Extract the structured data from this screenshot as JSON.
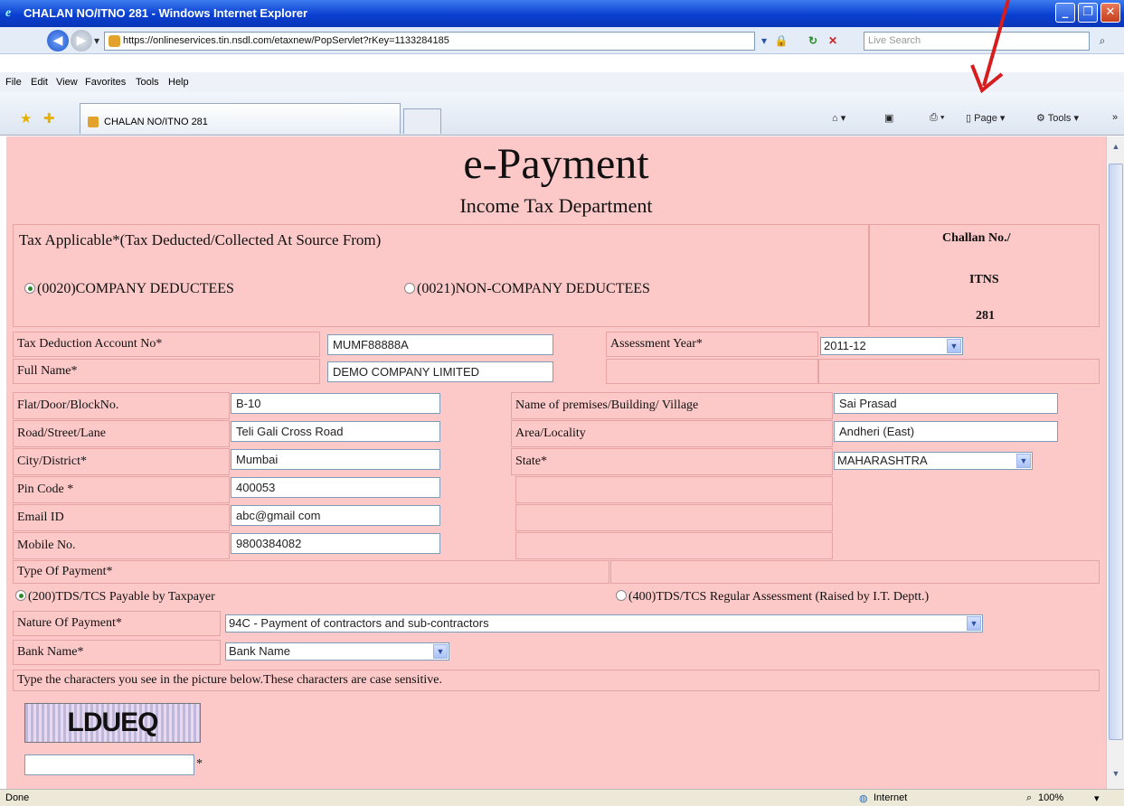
{
  "window": {
    "title": "CHALAN NO/ITNO 281 - Windows Internet Explorer"
  },
  "address": {
    "url": "https://onlineservices.tin.nsdl.com/etaxnew/PopServlet?rKey=1133284185",
    "search_placeholder": "Live Search"
  },
  "menu": [
    "File",
    "Edit",
    "View",
    "Favorites",
    "Tools",
    "Help"
  ],
  "tab": {
    "label": "CHALAN NO/ITNO 281"
  },
  "toolbar": {
    "page": "Page",
    "tools": "Tools"
  },
  "page": {
    "title": "e-Payment",
    "subtitle": "Income Tax Department",
    "tax_applicable_label": "Tax Applicable*(Tax Deducted/Collected At Source From)",
    "radio_company": "(0020)COMPANY DEDUCTEES",
    "radio_noncompany": "(0021)NON-COMPANY DEDUCTEES",
    "challan_l1": "Challan No./",
    "challan_l2": "ITNS",
    "challan_l3": "281",
    "tan_label": "Tax Deduction Account No*",
    "tan_value": "MUMF88888A",
    "ay_label": "Assessment Year*",
    "ay_value": "2011-12",
    "fullname_label": "Full Name*",
    "fullname_value": "DEMO COMPANY LIMITED",
    "flat_label": "Flat/Door/BlockNo.",
    "flat_value": "B-10",
    "premises_label": "Name of premises/Building/ Village",
    "premises_value": "Sai Prasad",
    "road_label": "Road/Street/Lane",
    "road_value": "Teli Gali Cross Road",
    "area_label": "Area/Locality",
    "area_value": "Andheri (East)",
    "city_label": "City/District*",
    "city_value": "Mumbai",
    "state_label": "State*",
    "state_value": "MAHARASHTRA",
    "pin_label": "Pin Code *",
    "pin_value": "400053",
    "email_label": "Email ID",
    "email_value": "abc@gmail com",
    "mobile_label": "Mobile No.",
    "mobile_value": "9800384082",
    "type_payment_label": "Type Of Payment*",
    "radio_200": "(200)TDS/TCS Payable by Taxpayer",
    "radio_400": "(400)TDS/TCS Regular Assessment (Raised by I.T. Deptt.)",
    "nature_label": "Nature Of Payment*",
    "nature_value": "94C - Payment of contractors and sub-contractors",
    "bank_label": "Bank Name*",
    "bank_value": "Bank Name",
    "captcha_instruction": "Type the characters you see in the picture below.These characters are case sensitive.",
    "captcha_text": "LDUEQ",
    "captcha_required_mark": "*"
  },
  "status": {
    "left": "Done",
    "zone": "Internet",
    "zoom": "100%"
  }
}
